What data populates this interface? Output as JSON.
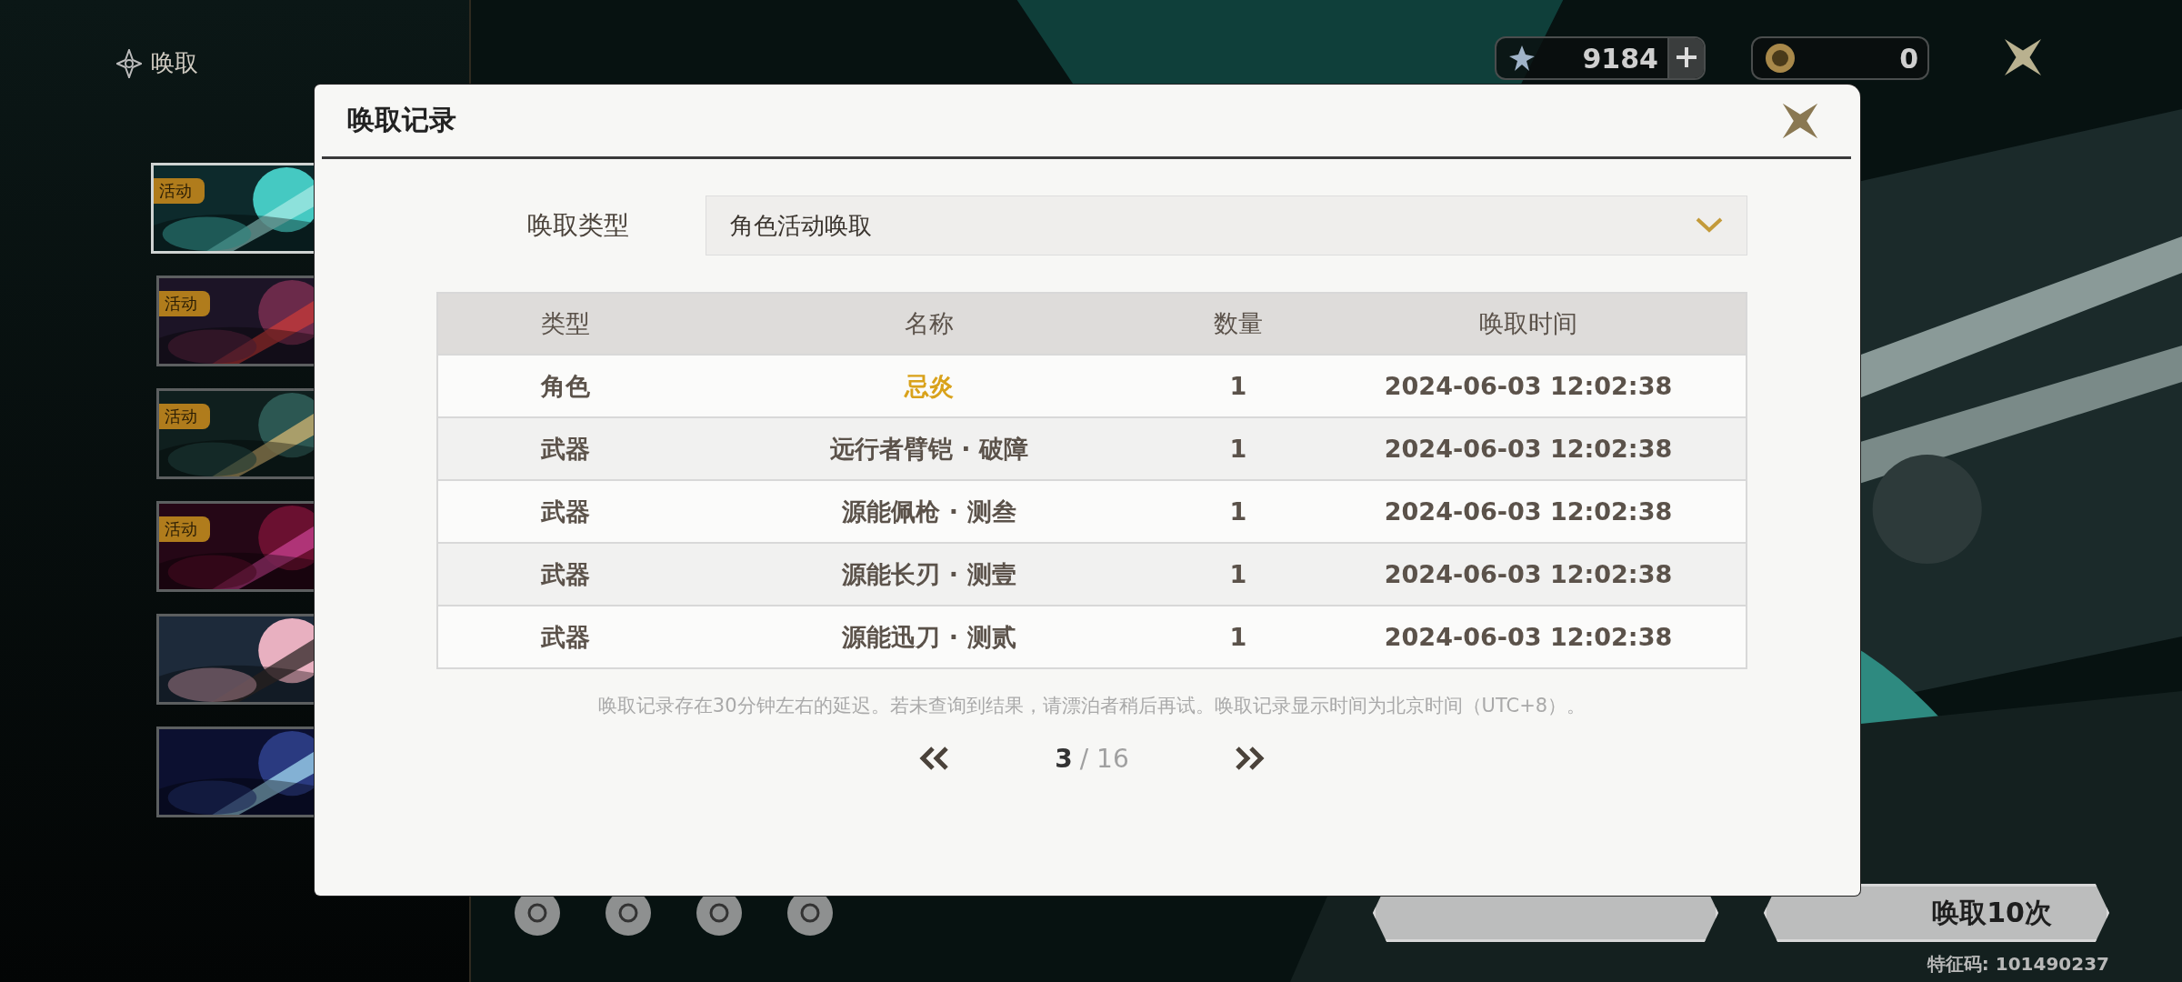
{
  "nav": {
    "title": "唤取"
  },
  "banners": [
    {
      "tag": "活动",
      "selected": true
    },
    {
      "tag": "活动",
      "selected": false
    },
    {
      "tag": "活动",
      "selected": false
    },
    {
      "tag": "活动",
      "selected": false
    },
    {
      "selected": false
    },
    {
      "selected": false
    }
  ],
  "currencies": [
    {
      "amount": "9184",
      "addable": true
    },
    {
      "amount": "0",
      "addable": false
    }
  ],
  "pull_button": {
    "label": "唤取10次"
  },
  "feature_code": "特征码: 101490237",
  "dialog": {
    "title": "唤取记录",
    "filter": {
      "label": "唤取类型",
      "value": "角色活动唤取"
    },
    "table": {
      "columns": [
        "类型",
        "名称",
        "数量",
        "唤取时间"
      ],
      "rows": [
        {
          "type": "角色",
          "name": "忌炎",
          "count": "1",
          "time": "2024-06-03 12:02:38",
          "color": "#d9a21b"
        },
        {
          "type": "武器",
          "name": "远行者臂铠 · 破障",
          "count": "1",
          "time": "2024-06-03 12:02:38",
          "color": "#5b524a"
        },
        {
          "type": "武器",
          "name": "源能佩枪 · 测叁",
          "count": "1",
          "time": "2024-06-03 12:02:38",
          "color": "#5b524a"
        },
        {
          "type": "武器",
          "name": "源能长刃 · 测壹",
          "count": "1",
          "time": "2024-06-03 12:02:38",
          "color": "#5b524a"
        },
        {
          "type": "武器",
          "name": "源能迅刀 · 测贰",
          "count": "1",
          "time": "2024-06-03 12:02:38",
          "color": "#5b524a"
        }
      ]
    },
    "note": "唤取记录存在30分钟左右的延迟。若未查询到结果，请漂泊者稍后再试。唤取记录显示时间为北京时间（UTC+8）。",
    "pagination": {
      "current": "3",
      "total": "/ 16"
    }
  }
}
